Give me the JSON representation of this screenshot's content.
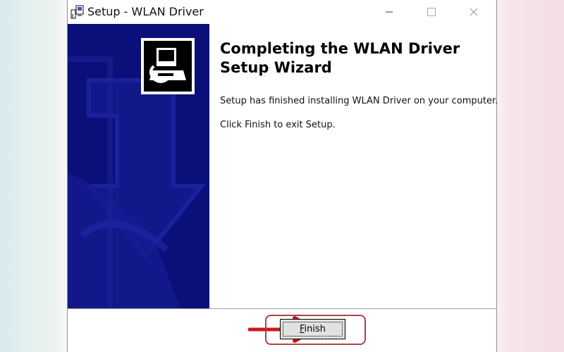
{
  "window": {
    "title": "Setup - WLAN Driver",
    "controls": {
      "minimize_icon": "minimize-icon",
      "maximize_icon": "maximize-icon",
      "close_icon": "close-icon"
    }
  },
  "banner": {
    "background_color": "#0b0f7a",
    "icon": "installer-computer-icon"
  },
  "content": {
    "heading_line1": "Completing the WLAN Driver",
    "heading_line2": "Setup Wizard",
    "paragraph1": "Setup has finished installing WLAN Driver on your computer.",
    "paragraph2": "Click Finish to exit Setup."
  },
  "footer": {
    "finish_button": {
      "mnemonic": "F",
      "rest": "inish"
    },
    "annotation": {
      "arrow_color": "#c81a1a",
      "highlight_color": "#b0404a"
    }
  }
}
